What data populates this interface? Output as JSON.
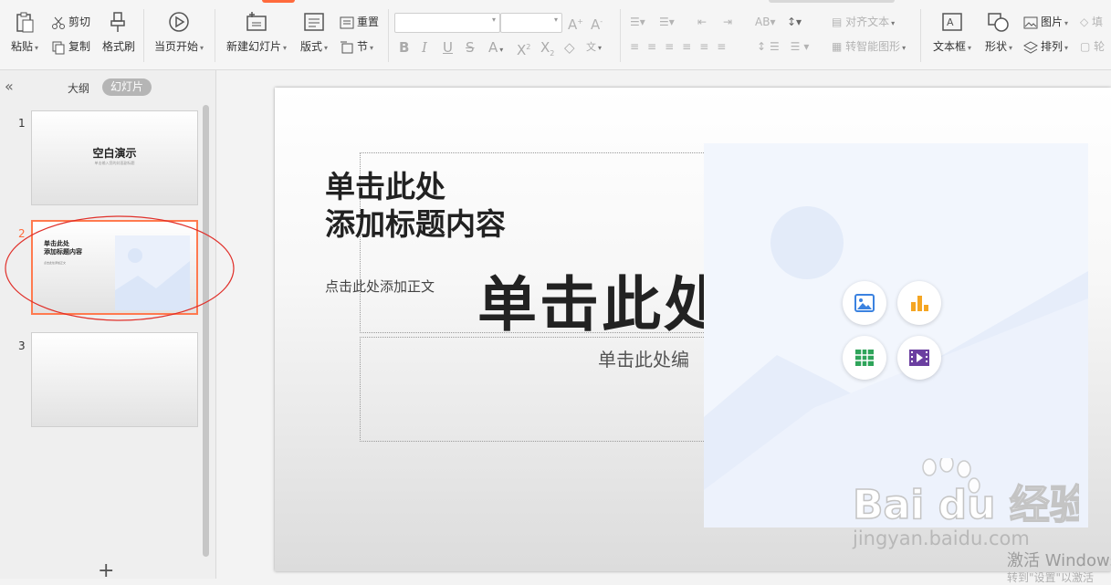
{
  "ribbon": {
    "paste": "粘贴",
    "cut": "剪切",
    "copy": "复制",
    "format_painter": "格式刷",
    "from_current": "当页开始",
    "new_slide": "新建幻灯片",
    "layout": "版式",
    "reset": "重置",
    "section": "节",
    "align_text": "对齐文本",
    "smartart": "转智能图形",
    "textbox": "文本框",
    "shape": "形状",
    "picture": "图片",
    "arrange": "排列",
    "fill": "填",
    "outline": "轮"
  },
  "panel": {
    "tab_outline": "大纲",
    "tab_slides": "幻灯片",
    "add_slide": "+",
    "thumbs": [
      {
        "num": "1",
        "title": "空白演示",
        "sub": "单击输入您的封面副标题"
      },
      {
        "num": "2",
        "title": "单击此处\n添加标题内容",
        "sub": "点击此处添加正文"
      },
      {
        "num": "3"
      }
    ]
  },
  "slide": {
    "title": "单击此处\n添加标题内容",
    "body": "点击此处添加正文",
    "big_title": "单击此处",
    "subtitle": "单击此处编"
  },
  "watermark": {
    "brand": "Bai du 经验",
    "url": "jingyan.baidu.com",
    "activate": "激活 Windows",
    "activate_sub": "转到\"设置\"以激活"
  },
  "colors": {
    "accent": "#ff6a3c",
    "selected_border": "#ff7a4f",
    "annotation": "#e0302a"
  }
}
